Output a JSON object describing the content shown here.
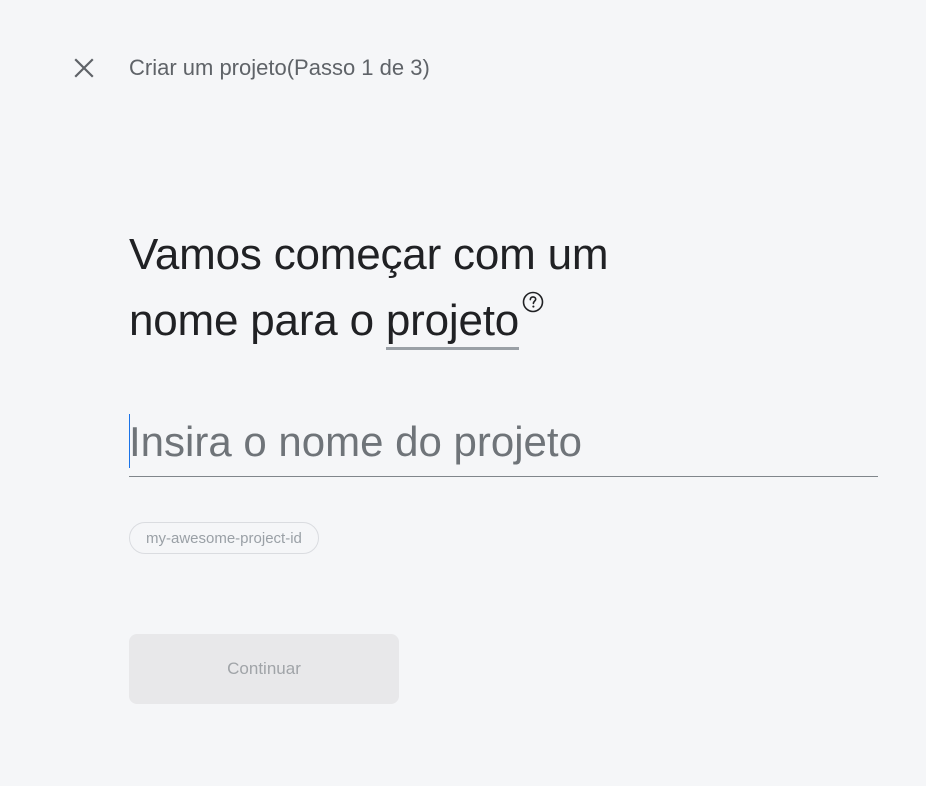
{
  "header": {
    "close_icon": "close-icon",
    "title": "Criar um projeto(Passo 1 de 3)"
  },
  "main": {
    "heading_line1": "Vamos começar com um",
    "heading_line2_prefix": "nome para o ",
    "heading_link_word": "projeto",
    "help_icon": "help-circle-icon",
    "name_input": {
      "value": "",
      "placeholder": "Insira o nome do projeto"
    },
    "project_id_chip": "my-awesome-project-id",
    "continue_label": "Continuar"
  },
  "colors": {
    "background": "#f5f6f8",
    "text_primary": "#202124",
    "text_secondary": "#5f6368",
    "button_disabled_bg": "#e8e8ea",
    "caret": "#1a73e8"
  }
}
